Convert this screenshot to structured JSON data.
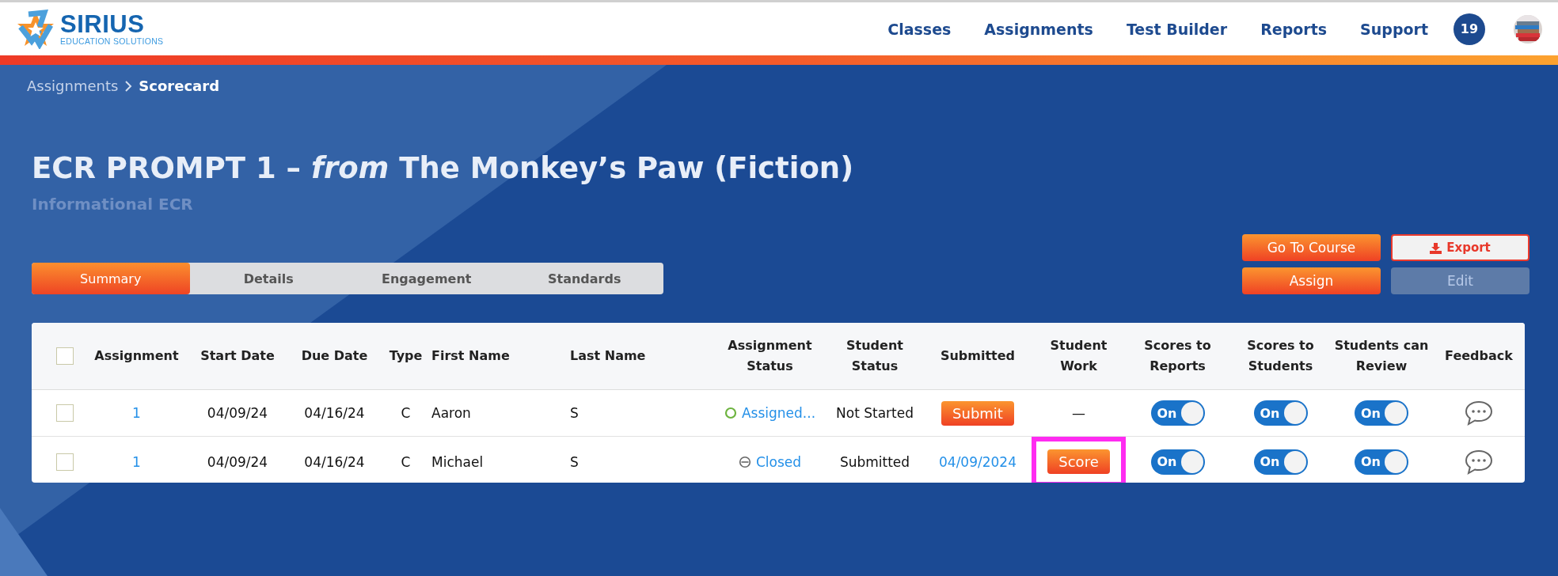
{
  "brand": {
    "name": "SIRIUS",
    "tagline": "EDUCATION SOLUTIONS"
  },
  "nav": [
    "Classes",
    "Assignments",
    "Test Builder",
    "Reports",
    "Support"
  ],
  "notifications": {
    "count": "19"
  },
  "breadcrumb": [
    {
      "label": "Assignments",
      "current": false
    },
    {
      "label": "Scorecard",
      "current": true
    }
  ],
  "title": "ECR PROMPT 1 – *from* The Monkey’s Paw (Fiction)",
  "subtitle": "Informational ECR",
  "tabs": [
    {
      "label": "Summary",
      "selected": true
    },
    {
      "label": "Details",
      "selected": false
    },
    {
      "label": "Engagement",
      "selected": false
    },
    {
      "label": "Standards",
      "selected": false
    }
  ],
  "actions": [
    {
      "label": "Go To Course",
      "kind": "primary",
      "disabled": false
    },
    {
      "label": "Export",
      "kind": "outline",
      "disabled": false
    },
    {
      "label": "Assign",
      "kind": "primary",
      "disabled": false
    },
    {
      "label": "Edit",
      "kind": "muted",
      "disabled": true
    }
  ],
  "table": {
    "select_all": {
      "checked": false
    },
    "columns": [
      "Assignment",
      "Start Date",
      "Due Date",
      "Type",
      "First Name",
      "Last Name",
      "Assignment Status",
      "Student Status",
      "Submitted",
      "Student Work",
      "Scores to Reports",
      "Scores to Students",
      "Students can Review",
      "Feedback"
    ],
    "rows": [
      {
        "checked": false,
        "assignment": "1",
        "start_date": "04/09/24",
        "due_date": "04/16/24",
        "type": "C",
        "first_name": "Aaron",
        "last_name": "S",
        "assignment_status": {
          "kind": "assigned",
          "label": "Assigned..."
        },
        "student_status": "Not Started",
        "submitted": {
          "kind": "button",
          "label": "Submit"
        },
        "student_work": {
          "kind": "text",
          "label": "—",
          "highlighted": false
        },
        "scores_to_reports": {
          "on": true,
          "label": "On"
        },
        "scores_to_students": {
          "on": true,
          "label": "On"
        },
        "students_can_review": {
          "on": true,
          "label": "On"
        }
      },
      {
        "checked": false,
        "assignment": "1",
        "start_date": "04/09/24",
        "due_date": "04/16/24",
        "type": "C",
        "first_name": "Michael",
        "last_name": "S",
        "assignment_status": {
          "kind": "closed",
          "label": "Closed"
        },
        "student_status": "Submitted",
        "submitted": {
          "kind": "link",
          "label": "04/09/2024"
        },
        "student_work": {
          "kind": "button",
          "label": "Score",
          "highlighted": true
        },
        "scores_to_reports": {
          "on": true,
          "label": "On"
        },
        "scores_to_students": {
          "on": true,
          "label": "On"
        },
        "students_can_review": {
          "on": true,
          "label": "On"
        }
      }
    ]
  }
}
